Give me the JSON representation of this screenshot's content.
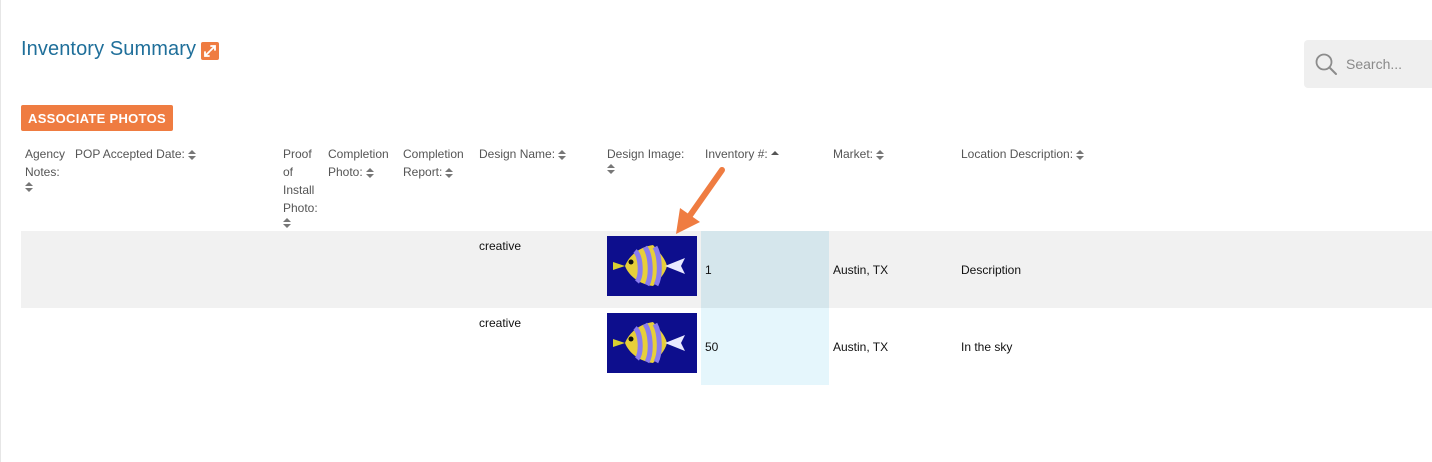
{
  "header": {
    "title": "Inventory Summary",
    "expand_icon": "external-expand-icon"
  },
  "search": {
    "placeholder": "Search..."
  },
  "toolbar": {
    "associate_label": "ASSOCIATE PHOTOS"
  },
  "table": {
    "columns": [
      {
        "label": "Agency Notes:"
      },
      {
        "label": "POP Accepted Date:"
      },
      {
        "label": "Proof of Install Photo:"
      },
      {
        "label": "Completion Photo:"
      },
      {
        "label": "Completion Report:"
      },
      {
        "label": "Design Name:"
      },
      {
        "label": "Design Image:"
      },
      {
        "label": "Inventory #:"
      },
      {
        "label": "Market:"
      },
      {
        "label": "Location Description:"
      }
    ],
    "rows": [
      {
        "design_name": "creative",
        "design_image": "fish-thumbnail",
        "inventory": "1",
        "market": "Austin, TX",
        "location": "Description"
      },
      {
        "design_name": "creative",
        "design_image": "fish-thumbnail",
        "inventory": "50",
        "market": "Austin, TX",
        "location": "In the sky"
      }
    ]
  },
  "colors": {
    "accent": "#ef7c41",
    "title": "#1f6f9a",
    "row_alt": "#f1f1f1",
    "sorted_col_1": "#d5e6ec",
    "sorted_col_2": "#e5f6fc"
  }
}
